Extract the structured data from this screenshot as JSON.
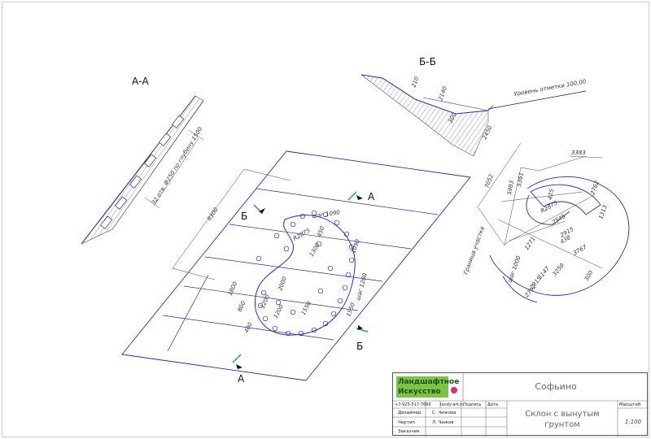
{
  "sections": {
    "aa": "А-А",
    "bb": "Б-Б",
    "a_marker": "А",
    "b_marker": "Б"
  },
  "aa_section": {
    "note": "32 отв. Ф250 по глубину 1500"
  },
  "bb_section": {
    "level": "Уровень отметки 100,00",
    "dims": [
      "210",
      "2140",
      "300",
      "2450"
    ]
  },
  "plan": {
    "length": "8300",
    "step_top": "шаг 1090",
    "radius": "R2875",
    "r_dim": "450",
    "d1": "1300",
    "d2": "1090",
    "step_side": "шаг 1200",
    "d3": "1800",
    "d4": "2000",
    "d5": "800",
    "d6": "1200",
    "d7": "1200",
    "d8": "400",
    "d9": "1550"
  },
  "detail": {
    "d_top": "3383",
    "d_a": "7052",
    "d_b": "5983",
    "d_c": "5361",
    "d_425": "425",
    "d_r": "R2875",
    "d_2762": "2762",
    "d_1313": "1313",
    "d_2545": "2545",
    "d_2915": "2915",
    "d_438": "438",
    "d_3767": "3767",
    "d_1271": "1271",
    "step": "шаг 1000",
    "d_3250": "3250",
    "d_3147": "3147",
    "d_2915b": "2915",
    "d_2752": "2752",
    "d_300": "300",
    "border": "Граница участка"
  },
  "title_block": {
    "logo_line1": "Ландшафтное",
    "logo_line2": "Искусство",
    "logo_color": "#1f8a3a",
    "logo_bg": "#7cc443",
    "dot_color": "#e0287c",
    "project": "Софьино",
    "phone": "+7-925-517-7660",
    "site": "landy-art.ru",
    "col_sign": "Подпись",
    "col_date": "Дата",
    "row1_role": "Дизайнер",
    "row1_name": "С. Чижова",
    "row2_role": "Чертил",
    "row2_name": "Л. Чижов",
    "row3_role": "Заказчик",
    "sheet_title_1": "Склон с вынутым",
    "sheet_title_2": "грунтом",
    "scale_label": "Масштаб",
    "scale_value": "1:100"
  }
}
